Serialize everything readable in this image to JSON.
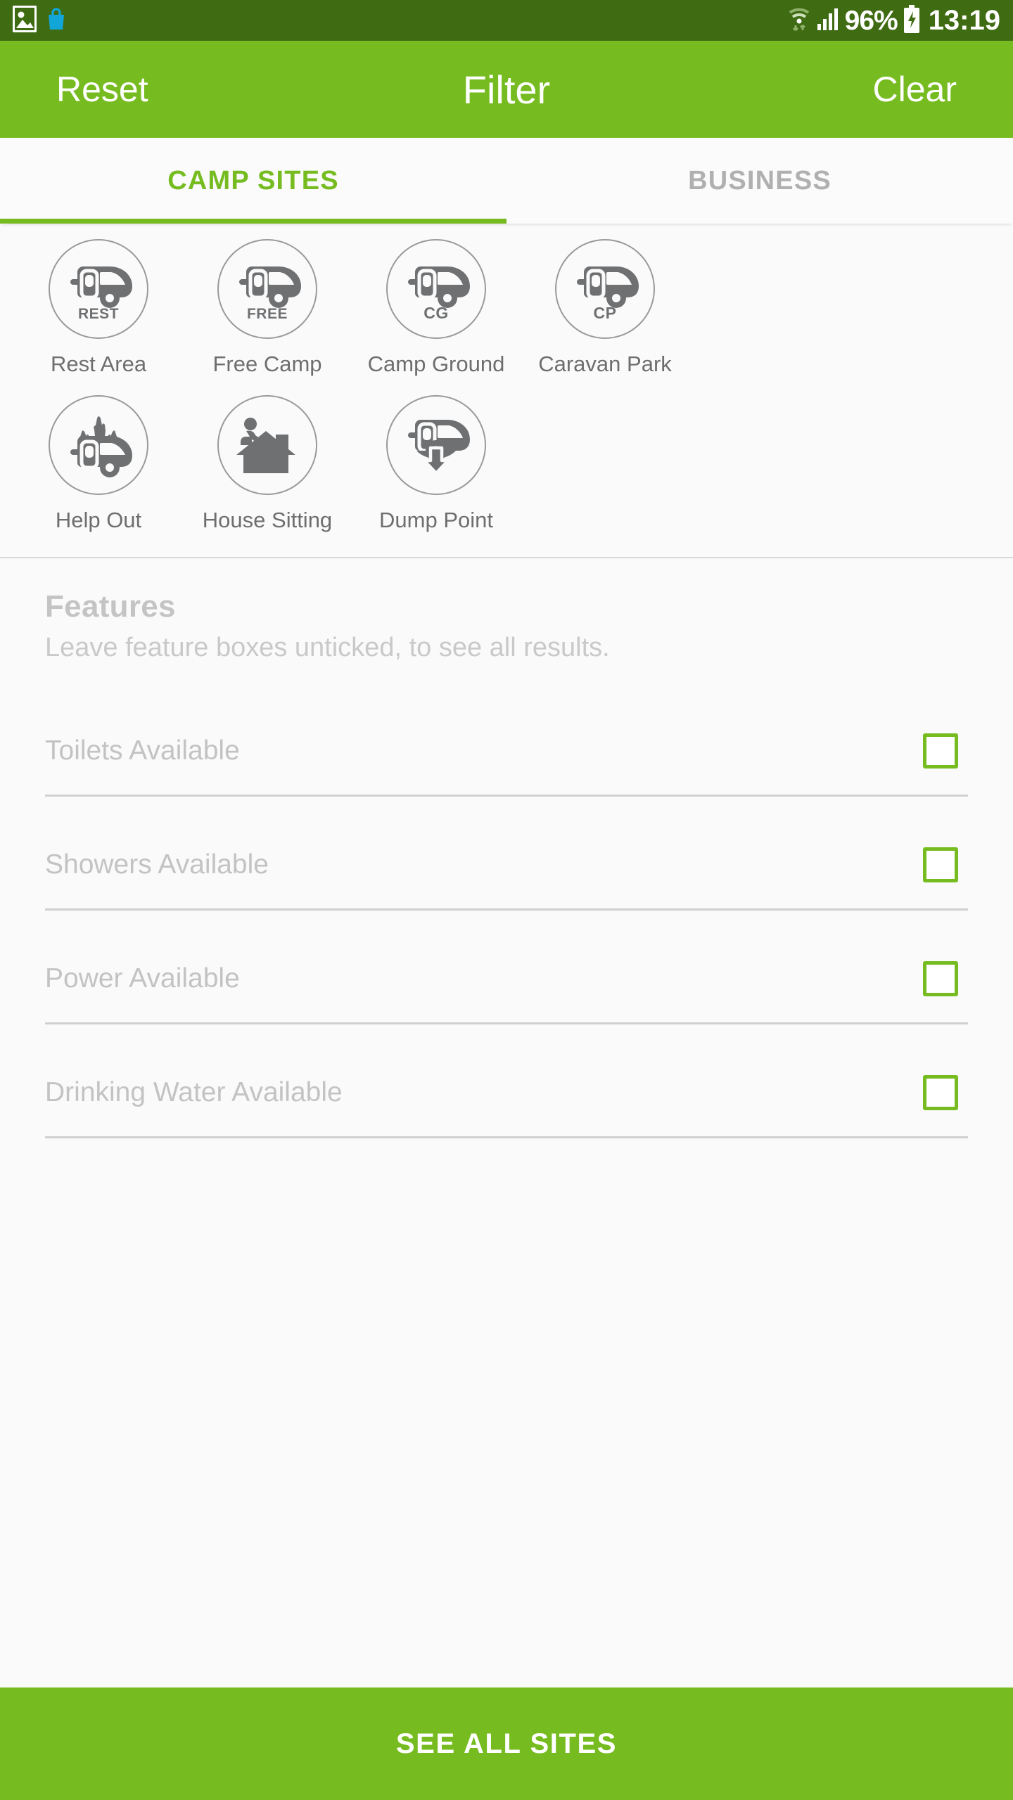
{
  "statusbar": {
    "icons_left": [
      "image-icon",
      "shopping-bag-icon"
    ],
    "icons_right": [
      "wifi-icon",
      "signal-icon",
      "battery-charging-icon"
    ],
    "battery_percent": "96%",
    "time": "13:19",
    "background_color": "#3f6b12"
  },
  "header": {
    "reset_label": "Reset",
    "title": "Filter",
    "clear_label": "Clear",
    "background_color": "#76bc21"
  },
  "tabs": [
    {
      "label": "CAMP SITES",
      "active": true,
      "color": "#76bc21"
    },
    {
      "label": "BUSINESS",
      "active": false,
      "color": "#b0b0b0"
    }
  ],
  "categories": [
    {
      "label": "Rest Area",
      "icon": "caravan-rest-icon",
      "badge": "REST"
    },
    {
      "label": "Free Camp",
      "icon": "caravan-free-icon",
      "badge": "FREE"
    },
    {
      "label": "Camp Ground",
      "icon": "caravan-cg-icon",
      "badge": "CG"
    },
    {
      "label": "Caravan Park",
      "icon": "caravan-cp-icon",
      "badge": "CP"
    },
    {
      "label": "Help Out",
      "icon": "helping-hands-caravan-icon",
      "badge": ""
    },
    {
      "label": "House Sitting",
      "icon": "person-on-house-icon",
      "badge": ""
    },
    {
      "label": "Dump Point",
      "icon": "caravan-down-arrow-icon",
      "badge": ""
    }
  ],
  "features": {
    "title": "Features",
    "subtitle": "Leave feature boxes unticked, to see all results.",
    "items": [
      {
        "label": "Toilets Available",
        "checked": false
      },
      {
        "label": "Showers Available",
        "checked": false
      },
      {
        "label": "Power Available",
        "checked": false
      },
      {
        "label": "Drinking Water Available",
        "checked": false
      }
    ],
    "checkbox_color": "#76bc21"
  },
  "footer": {
    "button_label": "SEE ALL SITES",
    "background_color": "#76bc21"
  }
}
